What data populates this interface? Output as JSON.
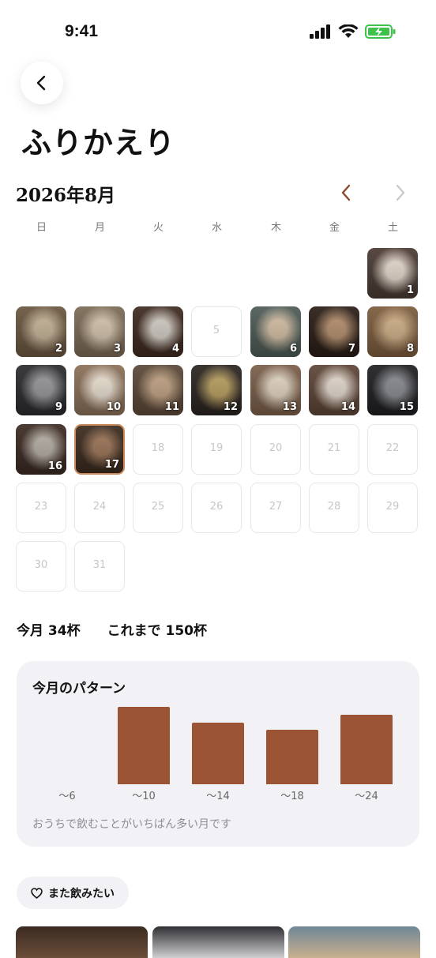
{
  "status_bar": {
    "time": "9:41"
  },
  "header": {
    "title": "ふりかえり"
  },
  "calendar": {
    "month_label": "2026年8月",
    "weekdays": [
      "日",
      "月",
      "火",
      "水",
      "木",
      "金",
      "土"
    ],
    "days": [
      {
        "num": "1",
        "photo": true,
        "colors": [
          "#4a3a33",
          "#e9ddd0"
        ]
      },
      {
        "num": "2",
        "photo": true,
        "colors": [
          "#6a5640",
          "#c9b79b"
        ]
      },
      {
        "num": "3",
        "photo": true,
        "colors": [
          "#7b6a56",
          "#d8c8b0"
        ]
      },
      {
        "num": "4",
        "photo": true,
        "colors": [
          "#3e2a1f",
          "#d6d0c8"
        ]
      },
      {
        "num": "5",
        "photo": false
      },
      {
        "num": "6",
        "photo": true,
        "colors": [
          "#4d5b57",
          "#d8c2a7"
        ]
      },
      {
        "num": "7",
        "photo": true,
        "colors": [
          "#2a1d16",
          "#b89270"
        ]
      },
      {
        "num": "8",
        "photo": true,
        "colors": [
          "#7c5c3d",
          "#d4b48b"
        ]
      },
      {
        "num": "9",
        "photo": true,
        "colors": [
          "#2b2b2e",
          "#9a9a9e"
        ]
      },
      {
        "num": "10",
        "photo": true,
        "colors": [
          "#8a7058",
          "#efe4d6"
        ]
      },
      {
        "num": "11",
        "photo": true,
        "colors": [
          "#5b4838",
          "#c5a686"
        ]
      },
      {
        "num": "12",
        "photo": true,
        "colors": [
          "#2a2420",
          "#bda363"
        ]
      },
      {
        "num": "13",
        "photo": true,
        "colors": [
          "#7a5e49",
          "#e6d9c6"
        ]
      },
      {
        "num": "14",
        "photo": true,
        "colors": [
          "#5d4436",
          "#e8ddd2"
        ]
      },
      {
        "num": "15",
        "photo": true,
        "colors": [
          "#1f1f22",
          "#8c8e94"
        ]
      },
      {
        "num": "16",
        "photo": true,
        "colors": [
          "#3b2a22",
          "#b9b2a8"
        ]
      },
      {
        "num": "17",
        "photo": true,
        "selected": true,
        "colors": [
          "#3a2a1e",
          "#a0785a"
        ]
      },
      {
        "num": "18",
        "photo": false
      },
      {
        "num": "19",
        "photo": false
      },
      {
        "num": "20",
        "photo": false
      },
      {
        "num": "21",
        "photo": false
      },
      {
        "num": "22",
        "photo": false
      },
      {
        "num": "23",
        "photo": false
      },
      {
        "num": "24",
        "photo": false
      },
      {
        "num": "25",
        "photo": false
      },
      {
        "num": "26",
        "photo": false
      },
      {
        "num": "27",
        "photo": false
      },
      {
        "num": "28",
        "photo": false
      },
      {
        "num": "29",
        "photo": false
      },
      {
        "num": "30",
        "photo": false
      },
      {
        "num": "31",
        "photo": false
      }
    ]
  },
  "totals": {
    "month": "今月 34杯",
    "all_time": "これまで 150杯"
  },
  "pattern": {
    "title": "今月のパターン",
    "note": "おうちで飲むことがいちばん多い月です",
    "chart_data": {
      "type": "bar",
      "categories": [
        "〜6",
        "〜10",
        "〜14",
        "〜18",
        "〜24"
      ],
      "values": [
        0,
        10,
        8,
        7,
        9
      ],
      "bar_color": "#9b5535"
    }
  },
  "favorites": {
    "chip_label": "また飲みたい"
  },
  "thumbnails": [
    {
      "colors": [
        "#3a2a20",
        "#6b4e3a"
      ]
    },
    {
      "colors": [
        "#2f2f33",
        "#cfcfd2"
      ]
    },
    {
      "colors": [
        "#6f8797",
        "#c9b08f"
      ]
    }
  ],
  "colors": {
    "accent": "#9b5535",
    "nav_active": "#8a4a2c",
    "nav_inactive": "#c8c8cc"
  }
}
